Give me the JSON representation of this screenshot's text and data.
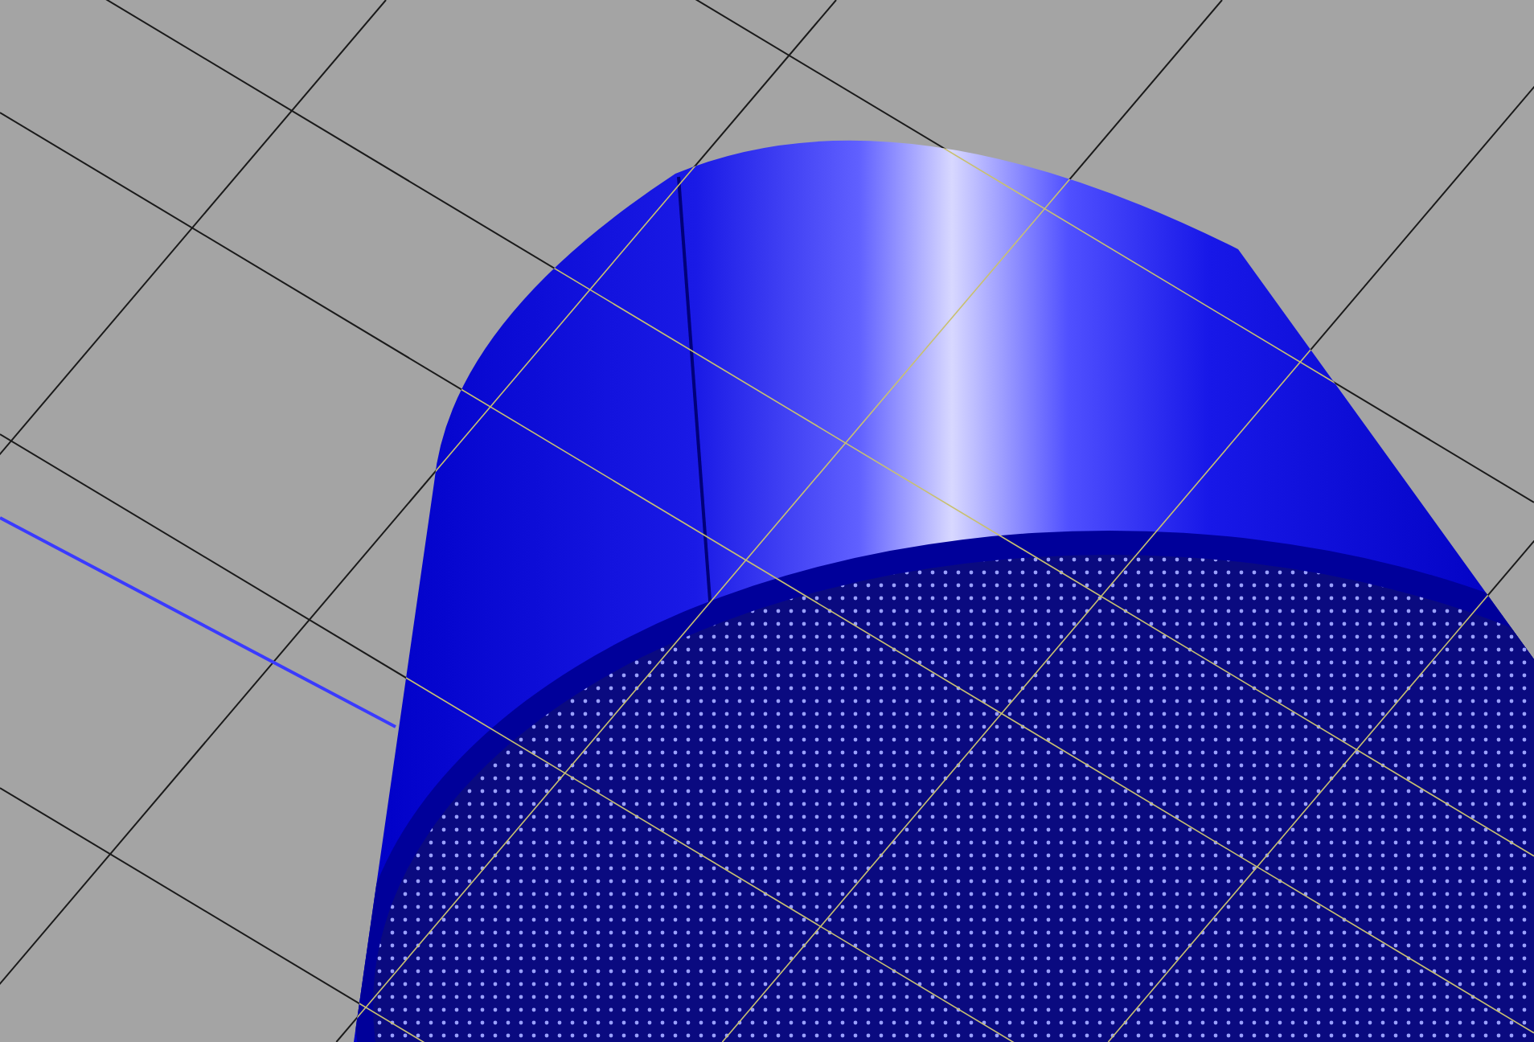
{
  "viewport": {
    "kind": "cylinder-preview"
  }
}
